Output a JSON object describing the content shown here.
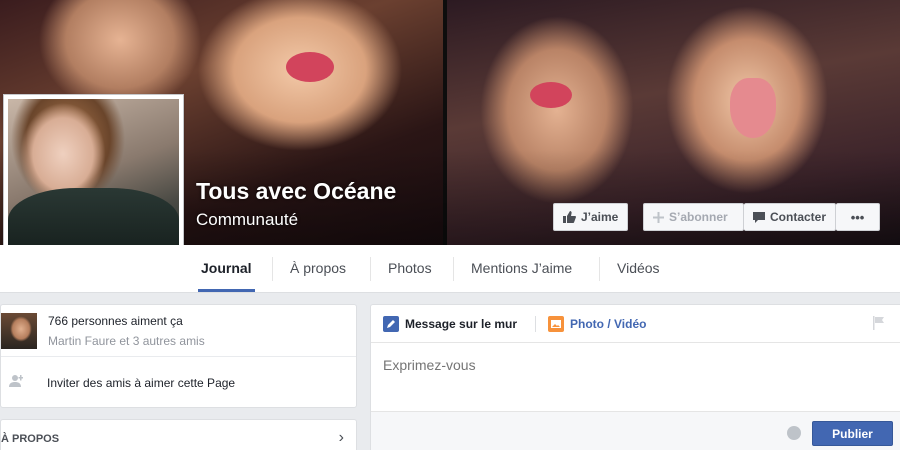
{
  "page": {
    "name": "Tous avec Océane",
    "category": "Communauté"
  },
  "actions": {
    "like": "J’aime",
    "subscribe": "S’abonner",
    "contact": "Contacter",
    "more": "•••"
  },
  "tabs": [
    "Journal",
    "À propos",
    "Photos",
    "Mentions J’aime",
    "Vidéos"
  ],
  "likes_box": {
    "count_text": "766 personnes aiment ça",
    "friends_text": "Martin Faure et 3 autres amis",
    "invite_text": "Inviter des amis à aimer cette Page"
  },
  "about": {
    "title": "À PROPOS"
  },
  "composer": {
    "tab_status": "Message sur le mur",
    "tab_photo": "Photo / Vidéo",
    "placeholder": "Exprimez-vous",
    "publish": "Publier"
  },
  "colors": {
    "accent": "#4267b2",
    "photo_icon": "#f7923b"
  }
}
